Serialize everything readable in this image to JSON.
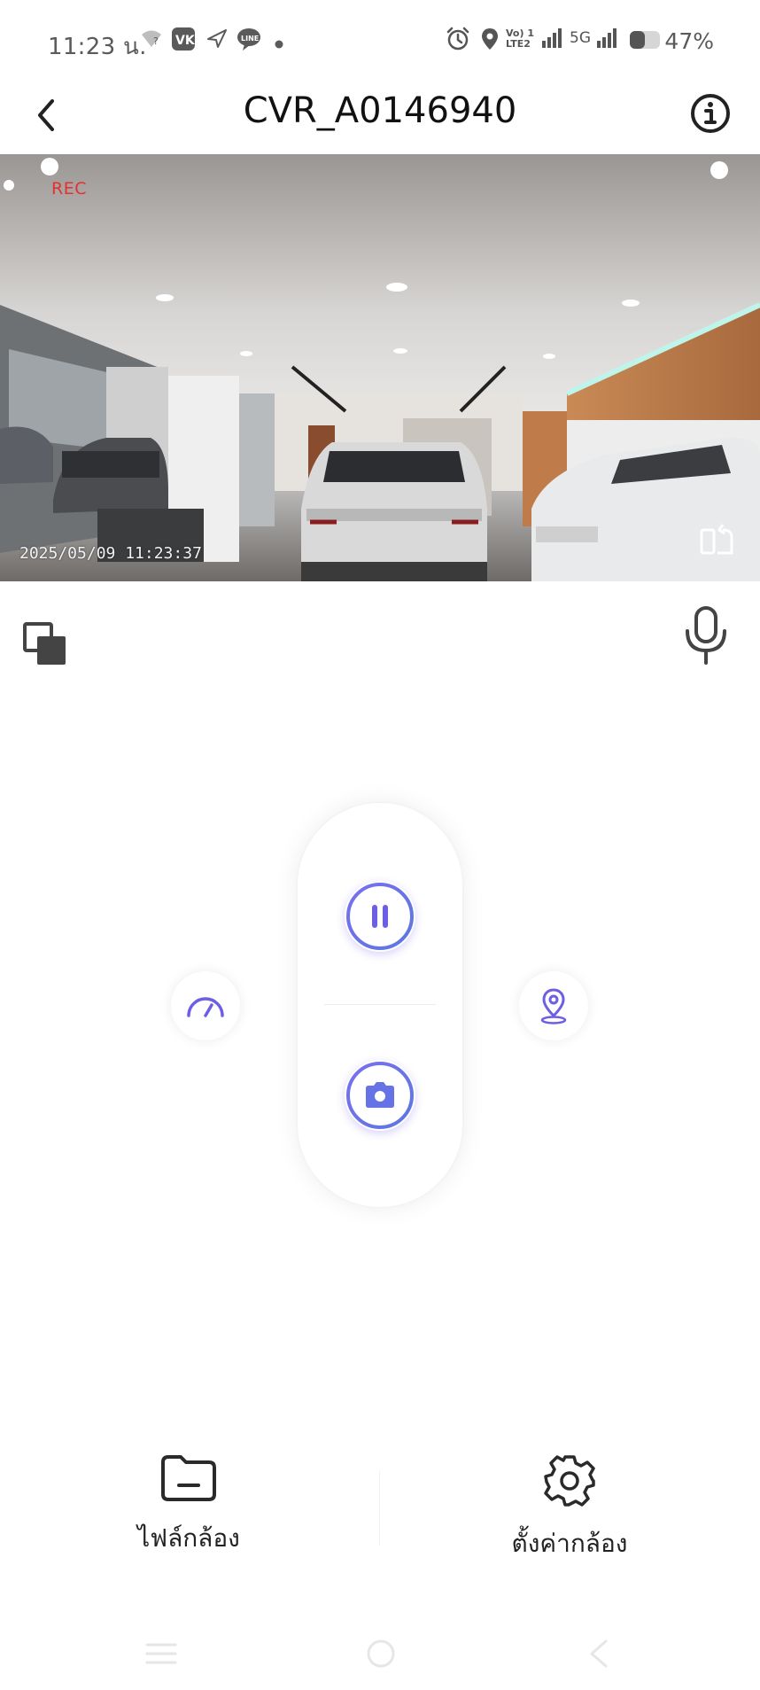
{
  "status_bar": {
    "time": "11:23 น.",
    "network": "5G",
    "volte": "Vo) 1 LTE2",
    "battery": "47%"
  },
  "header": {
    "title": "CVR_A0146940"
  },
  "video": {
    "rec_label": "REC",
    "timestamp": "2025/05/09 11:23:37"
  },
  "bottom": {
    "files_label": "ไฟล์กล้อง",
    "settings_label": "ตั้งค่ากล้อง"
  },
  "colors": {
    "accent": "#6f5de7",
    "accent_light": "#7b8ae8",
    "rec": "#e53030"
  }
}
